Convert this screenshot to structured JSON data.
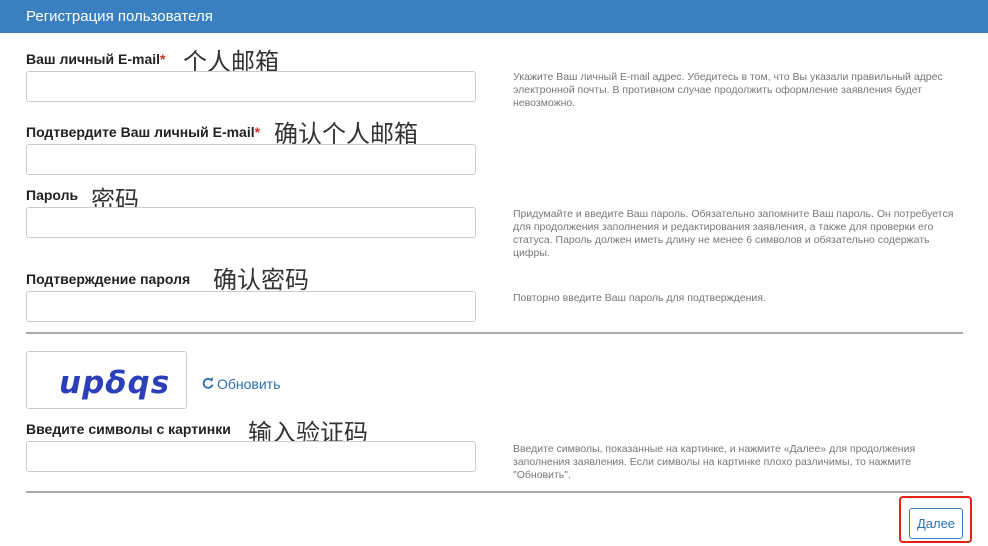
{
  "header": {
    "title": "Регистрация пользователя"
  },
  "fields": {
    "email": {
      "label": "Ваш личный E-mail",
      "required_mark": "*",
      "annotation": "个人邮箱",
      "value": "",
      "hint": "Укажите Ваш личный E-mail адрес. Убедитесь в том, что Вы указали правильный адрес электронной почты. В противном случае продолжить оформление заявления будет невозможно."
    },
    "email_confirm": {
      "label": "Подтвердите Ваш личный E-mail",
      "required_mark": "*",
      "annotation": "确认个人邮箱",
      "value": ""
    },
    "password": {
      "label": "Пароль",
      "annotation": "密码",
      "value": "",
      "hint": "Придумайте и введите Ваш пароль. Обязательно запомните Ваш пароль. Он потребуется для продолжения заполнения и редактирования заявления, а также для проверки его статуса. Пароль должен иметь длину не менее 6 символов и обязательно содержать цифры."
    },
    "password_confirm": {
      "label": "Подтверждение пароля",
      "annotation": "确认密码",
      "value": "",
      "hint": "Повторно введите Ваш пароль для подтверждения."
    },
    "captcha": {
      "image_text": "upδqs",
      "refresh_label": "Обновить",
      "refresh_icon": "refresh-icon",
      "label": "Введите символы с картинки",
      "annotation": "输入验证码",
      "value": "",
      "hint": "Введите символы, показанные на картинке, и нажмите «Далее» для продолжения заполнения заявления. Если символы на картинке плохо различимы, то нажмите \"Обновить\"."
    }
  },
  "actions": {
    "next_label": "Далее"
  },
  "colors": {
    "header_bg": "#3a80c0",
    "required": "#c9302c",
    "link": "#2a6fb0",
    "highlight": "#e2231a"
  }
}
